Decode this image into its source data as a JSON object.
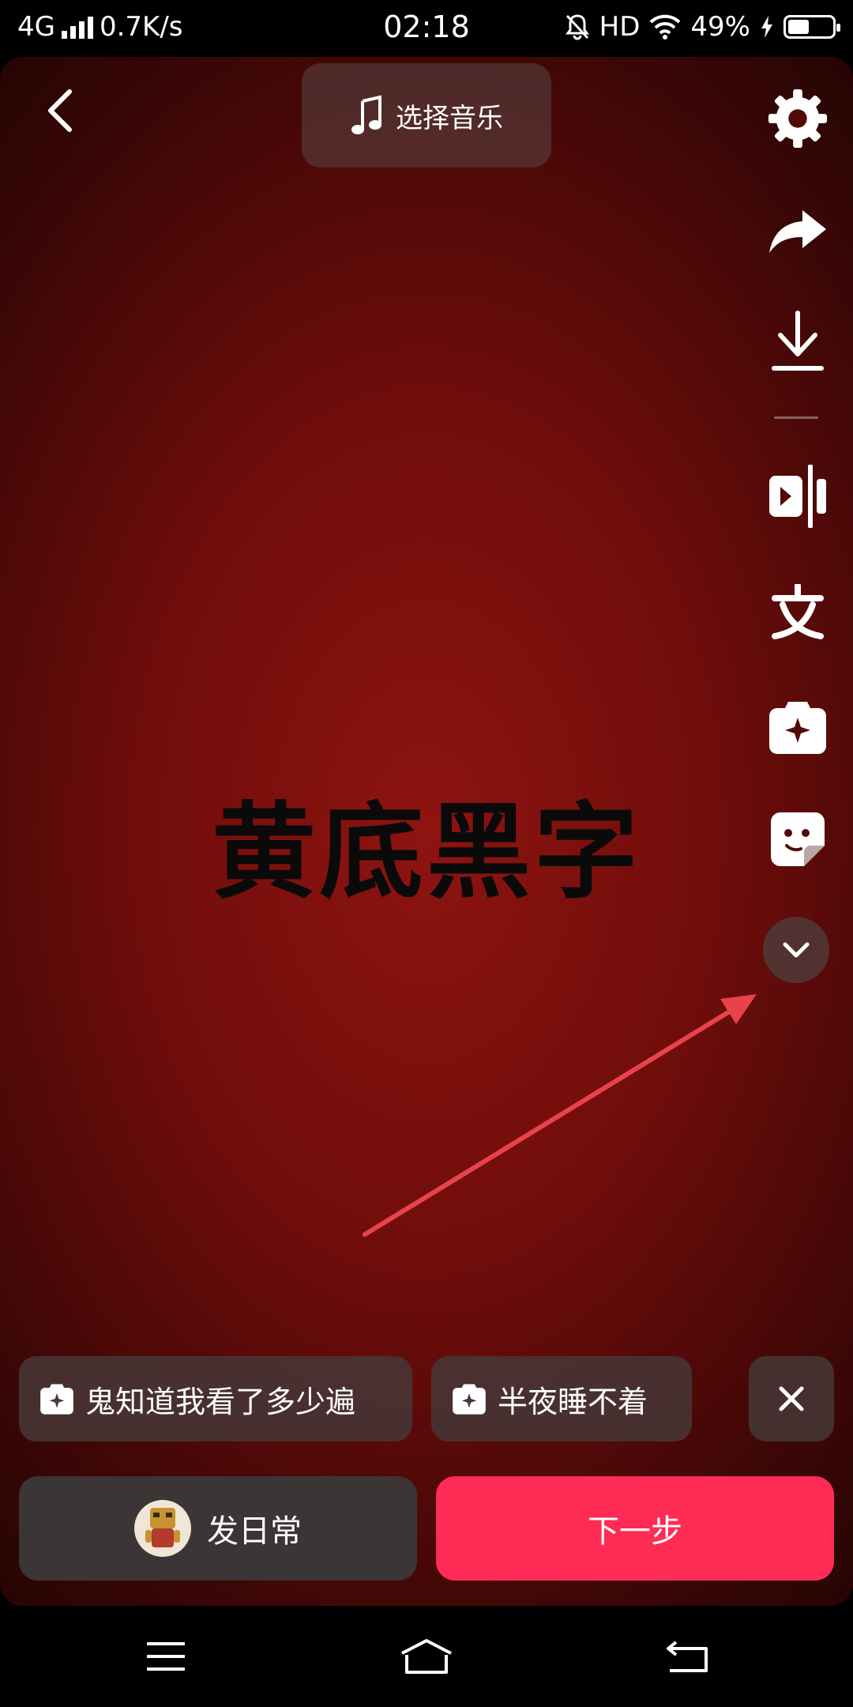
{
  "status_bar": {
    "network": "4G",
    "speed": "0.7K/s",
    "time": "02:18",
    "hd": "HD",
    "battery": "49%",
    "battery_level": 0.49
  },
  "editor": {
    "music_label": "选择音乐",
    "canvas_text": "黄底黑字",
    "canvas_colors": {
      "center": "#8e1410",
      "edge": "#1c0403",
      "text": "#0a0a0a"
    },
    "tools": [
      "settings-icon",
      "share-icon",
      "download-icon",
      "split-icon",
      "text-icon",
      "effects-icon",
      "sticker-icon",
      "chevron-down-icon"
    ]
  },
  "suggestions": [
    {
      "label": "鬼知道我看了多少遍"
    },
    {
      "label": "半夜睡不着"
    }
  ],
  "actions": {
    "daily_label": "发日常",
    "next_label": "下一步",
    "accent_color": "#fe2c55"
  },
  "annotation": {
    "arrow_color": "#e8434b"
  }
}
